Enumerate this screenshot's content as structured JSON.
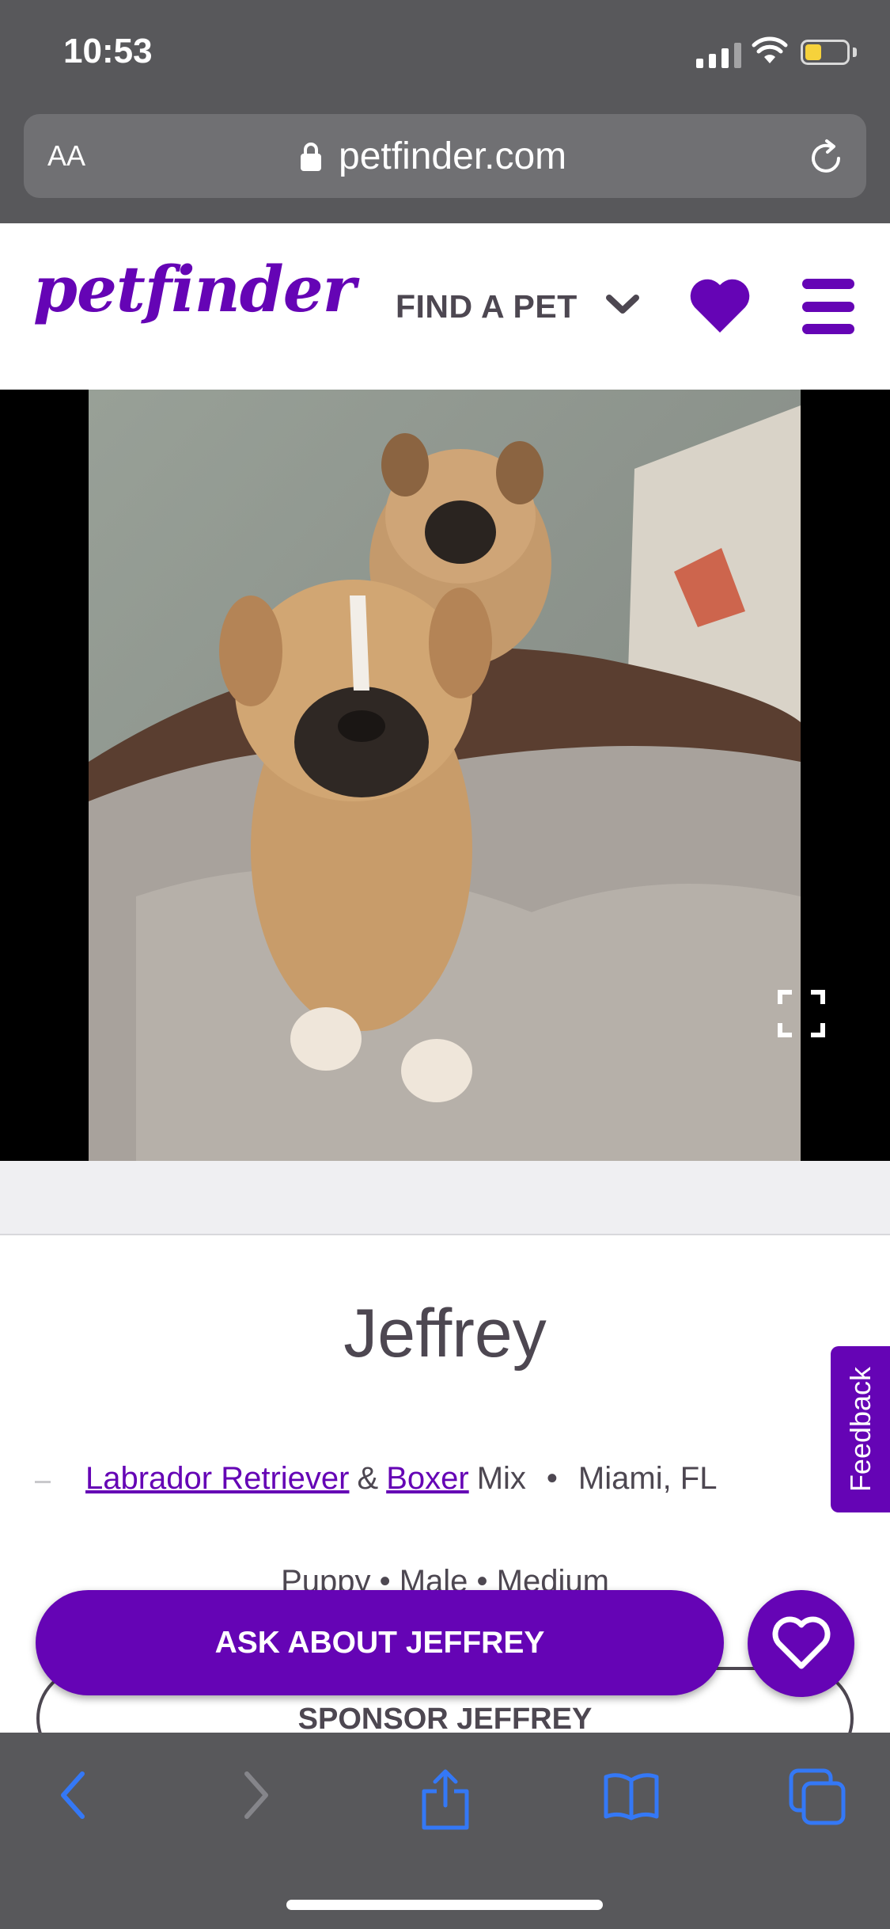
{
  "status_bar": {
    "time": "10:53"
  },
  "address_bar": {
    "text_size_button": "AA",
    "url": "petfinder.com"
  },
  "site_header": {
    "logo_text": "petfinder",
    "find_a_pet_label": "FIND A PET"
  },
  "pet": {
    "name": "Jeffrey",
    "breed_primary": "Labrador Retriever",
    "breed_join": "&",
    "breed_secondary": "Boxer",
    "breed_suffix": "Mix",
    "separator": "•",
    "location": "Miami, FL",
    "attributes": "Puppy  •  Male  •  Medium"
  },
  "actions": {
    "ask_label": "ASK ABOUT JEFFREY",
    "sponsor_label": "SPONSOR JEFFREY",
    "feedback_label": "Feedback"
  },
  "colors": {
    "brand": "#6504b5",
    "text": "#4d4751",
    "browser_chrome": "#58585b",
    "ios_blue": "#3478f6"
  },
  "icons": {
    "status": [
      "signal-icon",
      "wifi-icon",
      "battery-icon"
    ],
    "address": [
      "lock-icon",
      "reload-icon"
    ],
    "header": [
      "chevron-down-icon",
      "heart-icon",
      "menu-icon"
    ],
    "photo": [
      "expand-icon"
    ],
    "toolbar": [
      "back-icon",
      "forward-icon",
      "share-icon",
      "bookmarks-icon",
      "tabs-icon"
    ]
  }
}
